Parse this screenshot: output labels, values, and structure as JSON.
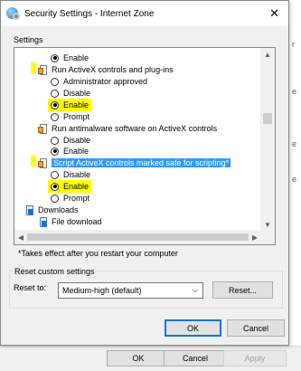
{
  "dialog": {
    "title": "Security Settings - Internet Zone",
    "settings_label": "Settings",
    "tree": {
      "r1": "Enable",
      "r2": "Run ActiveX controls and plug-ins",
      "r3": "Administrator approved",
      "r4": "Disable",
      "r5": "Enable",
      "r6": "Prompt",
      "r7": "Run antimalware software on ActiveX controls",
      "r8": "Disable",
      "r9": "Enable",
      "r10": "Script ActiveX controls marked safe for scripting*",
      "r11": "Disable",
      "r12": "Enable",
      "r13": "Prompt",
      "r14": "Downloads",
      "r15": "File download"
    },
    "note": "*Takes effect after you restart your computer",
    "reset": {
      "group_label": "Reset custom settings",
      "reset_to_label": "Reset to:",
      "selected": "Medium-high (default)",
      "reset_button": "Reset..."
    },
    "ok": "OK",
    "cancel": "Cancel"
  },
  "underlying": {
    "ok": "OK",
    "cancel": "Cancel",
    "apply": "Apply"
  },
  "colors": {
    "highlight": "#ffff00",
    "selection": "#3399ff",
    "default_button_border": "#0078d7"
  }
}
